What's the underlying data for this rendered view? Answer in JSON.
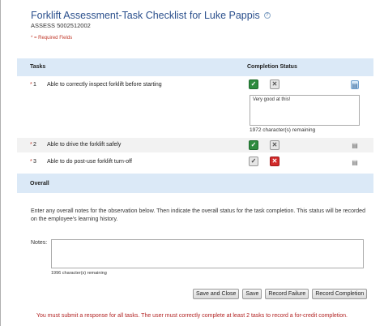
{
  "header": {
    "title": "Forklift Assessment-Task Checklist for Luke Pappis",
    "subtitle": "ASSESS 5002512002",
    "required_note": "* = Required Fields"
  },
  "tasks_table": {
    "col_tasks": "Tasks",
    "col_status": "Completion Status",
    "rows": [
      {
        "num": "1",
        "label": "Able to correctly inspect forklift before starting",
        "status": "complete",
        "comment": "Very good at this!",
        "remaining": "1972  character(s) remaining"
      },
      {
        "num": "2",
        "label": "Able to drive the forklift safely",
        "status": "complete"
      },
      {
        "num": "3",
        "label": "Able to do post-use forklift turn-off",
        "status": "failed"
      }
    ],
    "required_marker": "*"
  },
  "overall": {
    "heading": "Overall",
    "instructions": "Enter any overall notes for the observation below. Then indicate the overall status for the task completion. This status will be recorded on the employee's learning history.",
    "notes_label": "Notes:",
    "notes_value": "",
    "remaining": "1996  character(s) remaining"
  },
  "actions": {
    "save_close": "Save and Close",
    "save": "Save",
    "record_failure": "Record Failure",
    "record_completion": "Record Completion"
  },
  "footer_message": "You must submit a response for all tasks. The user must correctly complete at least 2 tasks to record a for-credit completion.",
  "icons": {
    "check": "✓",
    "cross": "✕",
    "note": "▤",
    "help": "?"
  },
  "colors": {
    "title": "#2a4f8c",
    "band": "#dbe9f7",
    "pass": "#2e8b3e",
    "fail": "#d22b2b",
    "error_text": "#b22222"
  }
}
